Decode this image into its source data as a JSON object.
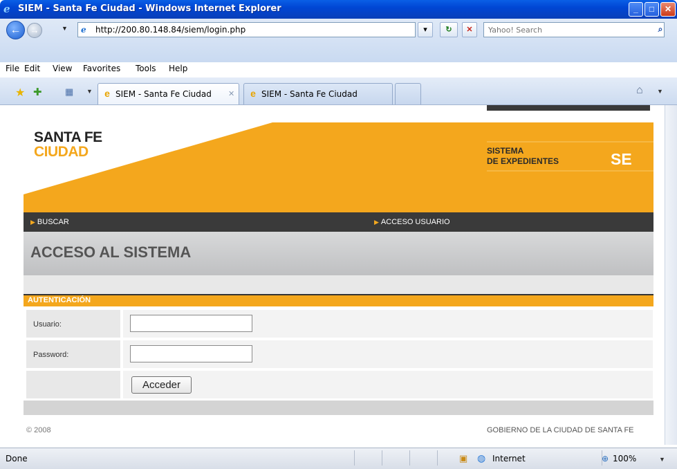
{
  "window": {
    "title": "SIEM - Santa Fe Ciudad - Windows Internet Explorer"
  },
  "address": {
    "url": "http://200.80.148.84/siem/login.php",
    "search_placeholder": "Yahoo! Search"
  },
  "menu": [
    "File",
    "Edit",
    "View",
    "Favorites",
    "Tools",
    "Help"
  ],
  "tabs": [
    {
      "label": "SIEM - Santa Fe Ciudad"
    },
    {
      "label": "SIEM - Santa Fe Ciudad"
    }
  ],
  "site": {
    "logo_line1": "SANTA FE",
    "logo_line2": "CIUDAD",
    "system_line1": "SISTEMA",
    "system_line2": "DE EXPEDIENTES",
    "system_abbr": "SE",
    "nav": [
      "BUSCAR",
      "ACCESO USUARIO"
    ],
    "page_title": "ACCESO AL SISTEMA",
    "section_label": "AUTENTICACIÓN",
    "username_label": "Usuario:",
    "password_label": "Password:",
    "submit_label": "Acceder",
    "footer_left": "© 2008",
    "footer_right": "GOBIERNO DE LA CIUDAD DE SANTA FE"
  },
  "status": {
    "text": "Done",
    "zone": "Internet",
    "zoom": "100%"
  },
  "colors": {
    "accent_orange": "#f4a71d",
    "nav_dark": "#3a3a3a",
    "xp_blue": "#0046d4"
  }
}
